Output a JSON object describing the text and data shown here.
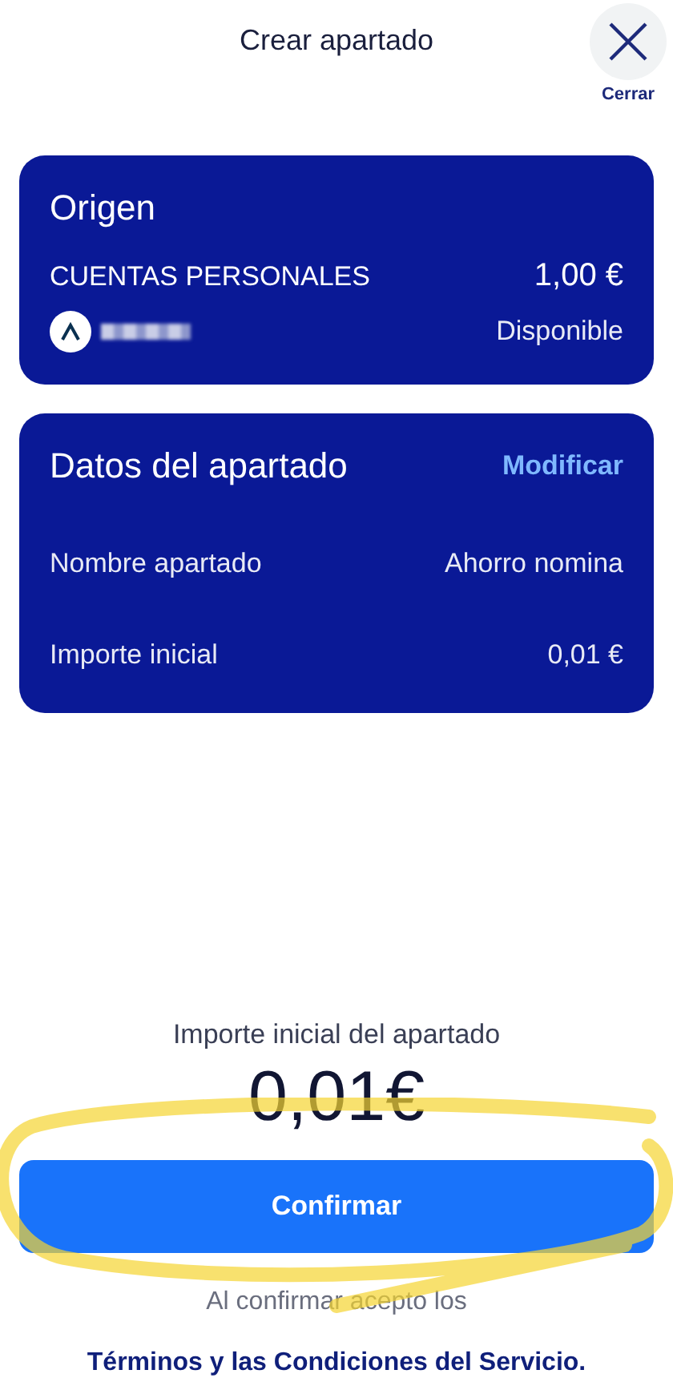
{
  "header": {
    "title": "Crear apartado",
    "close_label": "Cerrar"
  },
  "origin": {
    "title": "Origen",
    "account": "CUENTAS PERSONALES",
    "balance": "1,00 €",
    "balance_label": "Disponible"
  },
  "details": {
    "title": "Datos del apartado",
    "action": "Modificar",
    "rows": [
      {
        "label": "Nombre apartado",
        "value": "Ahorro nomina"
      },
      {
        "label": "Importe inicial",
        "value": "0,01 €"
      }
    ]
  },
  "summary": {
    "label": "Importe inicial del apartado",
    "amount": "0,01€"
  },
  "confirm_button": "Confirmar",
  "legal": {
    "text": "Al confirmar acepto los",
    "link": "Términos y las Condiciones del Servicio."
  }
}
